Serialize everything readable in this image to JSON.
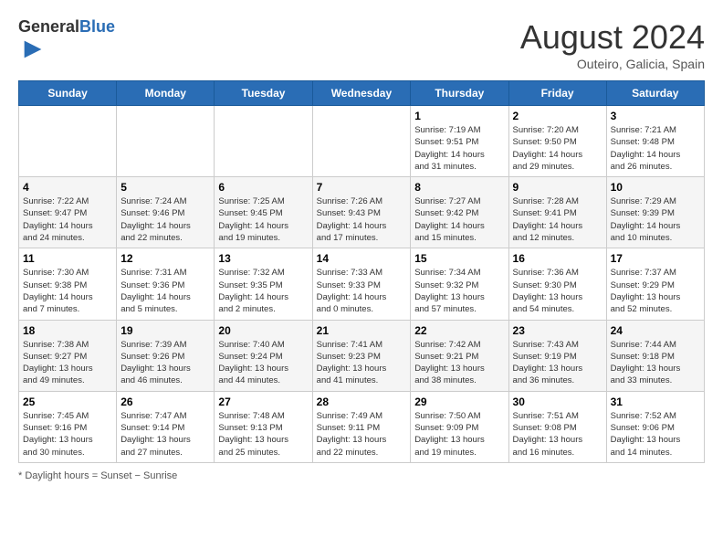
{
  "header": {
    "logo_general": "General",
    "logo_blue": "Blue",
    "month_title": "August 2024",
    "subtitle": "Outeiro, Galicia, Spain"
  },
  "days_of_week": [
    "Sunday",
    "Monday",
    "Tuesday",
    "Wednesday",
    "Thursday",
    "Friday",
    "Saturday"
  ],
  "footer": {
    "daylight_hours": "Daylight hours"
  },
  "weeks": [
    [
      {
        "num": "",
        "info": ""
      },
      {
        "num": "",
        "info": ""
      },
      {
        "num": "",
        "info": ""
      },
      {
        "num": "",
        "info": ""
      },
      {
        "num": "1",
        "info": "Sunrise: 7:19 AM\nSunset: 9:51 PM\nDaylight: 14 hours\nand 31 minutes."
      },
      {
        "num": "2",
        "info": "Sunrise: 7:20 AM\nSunset: 9:50 PM\nDaylight: 14 hours\nand 29 minutes."
      },
      {
        "num": "3",
        "info": "Sunrise: 7:21 AM\nSunset: 9:48 PM\nDaylight: 14 hours\nand 26 minutes."
      }
    ],
    [
      {
        "num": "4",
        "info": "Sunrise: 7:22 AM\nSunset: 9:47 PM\nDaylight: 14 hours\nand 24 minutes."
      },
      {
        "num": "5",
        "info": "Sunrise: 7:24 AM\nSunset: 9:46 PM\nDaylight: 14 hours\nand 22 minutes."
      },
      {
        "num": "6",
        "info": "Sunrise: 7:25 AM\nSunset: 9:45 PM\nDaylight: 14 hours\nand 19 minutes."
      },
      {
        "num": "7",
        "info": "Sunrise: 7:26 AM\nSunset: 9:43 PM\nDaylight: 14 hours\nand 17 minutes."
      },
      {
        "num": "8",
        "info": "Sunrise: 7:27 AM\nSunset: 9:42 PM\nDaylight: 14 hours\nand 15 minutes."
      },
      {
        "num": "9",
        "info": "Sunrise: 7:28 AM\nSunset: 9:41 PM\nDaylight: 14 hours\nand 12 minutes."
      },
      {
        "num": "10",
        "info": "Sunrise: 7:29 AM\nSunset: 9:39 PM\nDaylight: 14 hours\nand 10 minutes."
      }
    ],
    [
      {
        "num": "11",
        "info": "Sunrise: 7:30 AM\nSunset: 9:38 PM\nDaylight: 14 hours\nand 7 minutes."
      },
      {
        "num": "12",
        "info": "Sunrise: 7:31 AM\nSunset: 9:36 PM\nDaylight: 14 hours\nand 5 minutes."
      },
      {
        "num": "13",
        "info": "Sunrise: 7:32 AM\nSunset: 9:35 PM\nDaylight: 14 hours\nand 2 minutes."
      },
      {
        "num": "14",
        "info": "Sunrise: 7:33 AM\nSunset: 9:33 PM\nDaylight: 14 hours\nand 0 minutes."
      },
      {
        "num": "15",
        "info": "Sunrise: 7:34 AM\nSunset: 9:32 PM\nDaylight: 13 hours\nand 57 minutes."
      },
      {
        "num": "16",
        "info": "Sunrise: 7:36 AM\nSunset: 9:30 PM\nDaylight: 13 hours\nand 54 minutes."
      },
      {
        "num": "17",
        "info": "Sunrise: 7:37 AM\nSunset: 9:29 PM\nDaylight: 13 hours\nand 52 minutes."
      }
    ],
    [
      {
        "num": "18",
        "info": "Sunrise: 7:38 AM\nSunset: 9:27 PM\nDaylight: 13 hours\nand 49 minutes."
      },
      {
        "num": "19",
        "info": "Sunrise: 7:39 AM\nSunset: 9:26 PM\nDaylight: 13 hours\nand 46 minutes."
      },
      {
        "num": "20",
        "info": "Sunrise: 7:40 AM\nSunset: 9:24 PM\nDaylight: 13 hours\nand 44 minutes."
      },
      {
        "num": "21",
        "info": "Sunrise: 7:41 AM\nSunset: 9:23 PM\nDaylight: 13 hours\nand 41 minutes."
      },
      {
        "num": "22",
        "info": "Sunrise: 7:42 AM\nSunset: 9:21 PM\nDaylight: 13 hours\nand 38 minutes."
      },
      {
        "num": "23",
        "info": "Sunrise: 7:43 AM\nSunset: 9:19 PM\nDaylight: 13 hours\nand 36 minutes."
      },
      {
        "num": "24",
        "info": "Sunrise: 7:44 AM\nSunset: 9:18 PM\nDaylight: 13 hours\nand 33 minutes."
      }
    ],
    [
      {
        "num": "25",
        "info": "Sunrise: 7:45 AM\nSunset: 9:16 PM\nDaylight: 13 hours\nand 30 minutes."
      },
      {
        "num": "26",
        "info": "Sunrise: 7:47 AM\nSunset: 9:14 PM\nDaylight: 13 hours\nand 27 minutes."
      },
      {
        "num": "27",
        "info": "Sunrise: 7:48 AM\nSunset: 9:13 PM\nDaylight: 13 hours\nand 25 minutes."
      },
      {
        "num": "28",
        "info": "Sunrise: 7:49 AM\nSunset: 9:11 PM\nDaylight: 13 hours\nand 22 minutes."
      },
      {
        "num": "29",
        "info": "Sunrise: 7:50 AM\nSunset: 9:09 PM\nDaylight: 13 hours\nand 19 minutes."
      },
      {
        "num": "30",
        "info": "Sunrise: 7:51 AM\nSunset: 9:08 PM\nDaylight: 13 hours\nand 16 minutes."
      },
      {
        "num": "31",
        "info": "Sunrise: 7:52 AM\nSunset: 9:06 PM\nDaylight: 13 hours\nand 14 minutes."
      }
    ]
  ]
}
